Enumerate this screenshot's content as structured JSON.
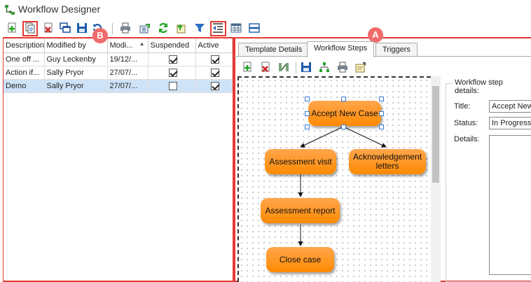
{
  "window": {
    "title": "Workflow Designer"
  },
  "callouts": {
    "a": "A",
    "b": "B"
  },
  "templates_grid": {
    "columns": [
      "Description",
      "Modified by",
      "Modi...",
      "Suspended",
      "Active"
    ],
    "rows": [
      {
        "description": "One off ...",
        "modified_by": "Guy Leckenby",
        "modified": "19/12/...",
        "suspended": true,
        "active": true
      },
      {
        "description": "Action if...",
        "modified_by": "Sally Pryor",
        "modified": "27/07/...",
        "suspended": true,
        "active": true
      },
      {
        "description": "Demo",
        "modified_by": "Sally Pryor",
        "modified": "27/07/...",
        "suspended": false,
        "active": true
      }
    ],
    "selected_row": 2
  },
  "tabs": [
    {
      "label": "Template Details",
      "active": false
    },
    {
      "label": "Workflow Steps",
      "active": true
    },
    {
      "label": "Triggers",
      "active": false
    }
  ],
  "workflow_nodes": [
    {
      "label": "Accept New Case",
      "selected": true
    },
    {
      "label": "Assessment visit"
    },
    {
      "label": "Acknowledgement letters"
    },
    {
      "label": "Assessment report"
    },
    {
      "label": "Close case"
    }
  ],
  "step_details": {
    "legend": "Workflow step details:",
    "title_label": "Title:",
    "title_value": "Accept New",
    "status_label": "Status:",
    "status_value": "In Progress",
    "details_label": "Details:"
  },
  "colors": {
    "callout": "#f06b6b",
    "highlight_box": "#e53935",
    "node_fill": "#ff9a2e",
    "selection": "#cfe3f7"
  }
}
